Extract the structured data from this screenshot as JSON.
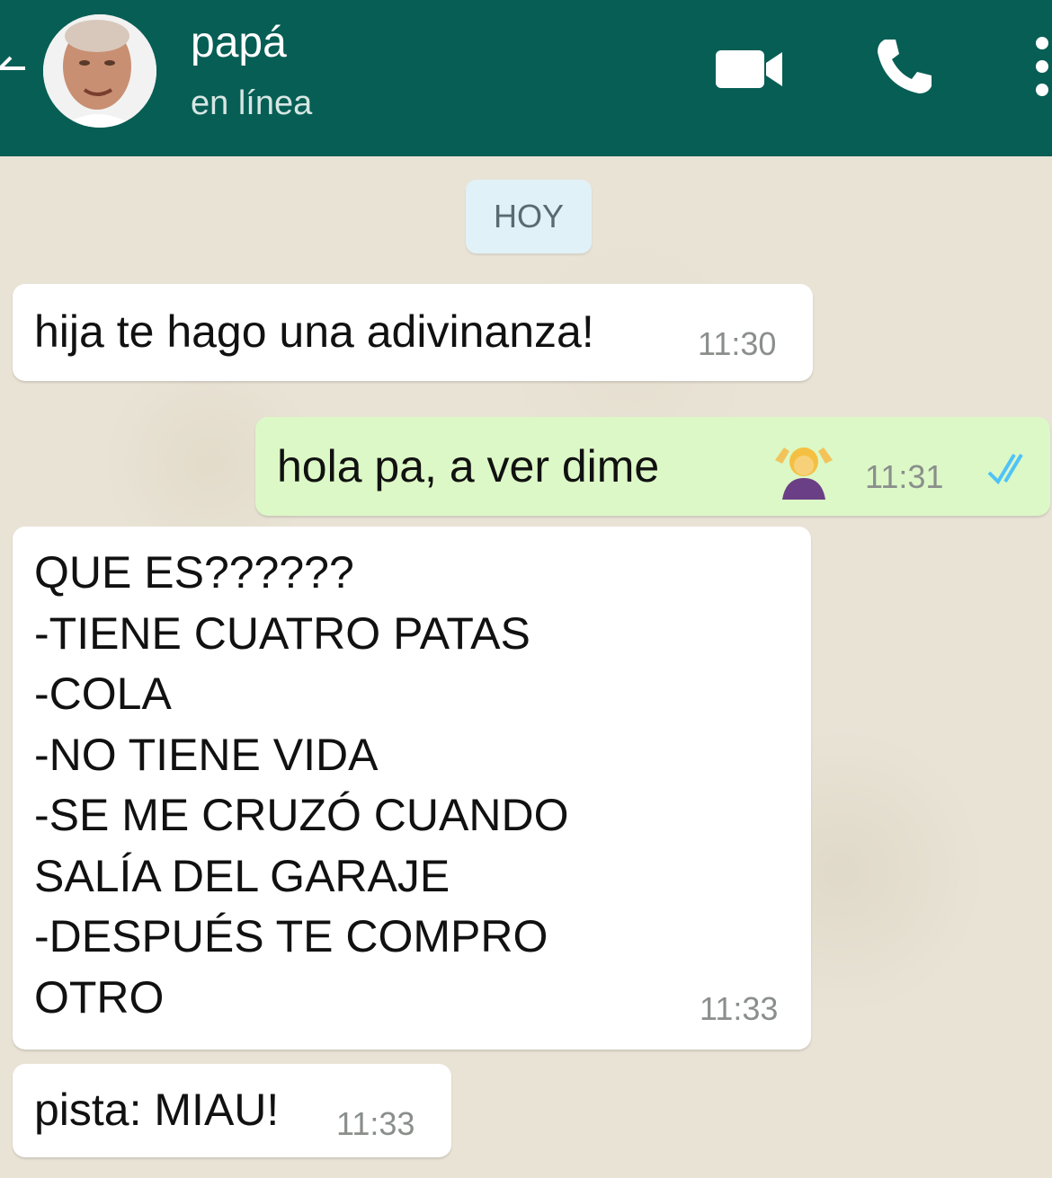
{
  "contact": {
    "name": "papá",
    "status": "en línea"
  },
  "header_icons": [
    "back-arrow-icon",
    "video-call-icon",
    "phone-icon",
    "more-options-icon"
  ],
  "date_chip": "HOY",
  "messages": [
    {
      "direction": "incoming",
      "text": "hija te hago una adivinanza!",
      "time": "11:30"
    },
    {
      "direction": "outgoing",
      "text": "hola pa, a ver dime",
      "emoji": "woman-shrugging-emoji",
      "time": "11:31",
      "read_ticks": "double-check-icon"
    },
    {
      "direction": "incoming",
      "lines": [
        "QUE ES??????",
        "-TIENE CUATRO PATAS",
        "-COLA",
        "-NO TIENE VIDA",
        "-SE ME CRUZÓ CUANDO",
        "SALÍA DEL GARAJE",
        "-DESPUÉS TE COMPRO",
        "OTRO"
      ],
      "time": "11:33"
    },
    {
      "direction": "incoming",
      "text": "pista: MIAU!",
      "time": "11:33"
    }
  ],
  "colors": {
    "header": "#075e54",
    "outgoing_bubble": "#dcf8c6",
    "incoming_bubble": "#ffffff",
    "tick": "#4fc3f7"
  }
}
